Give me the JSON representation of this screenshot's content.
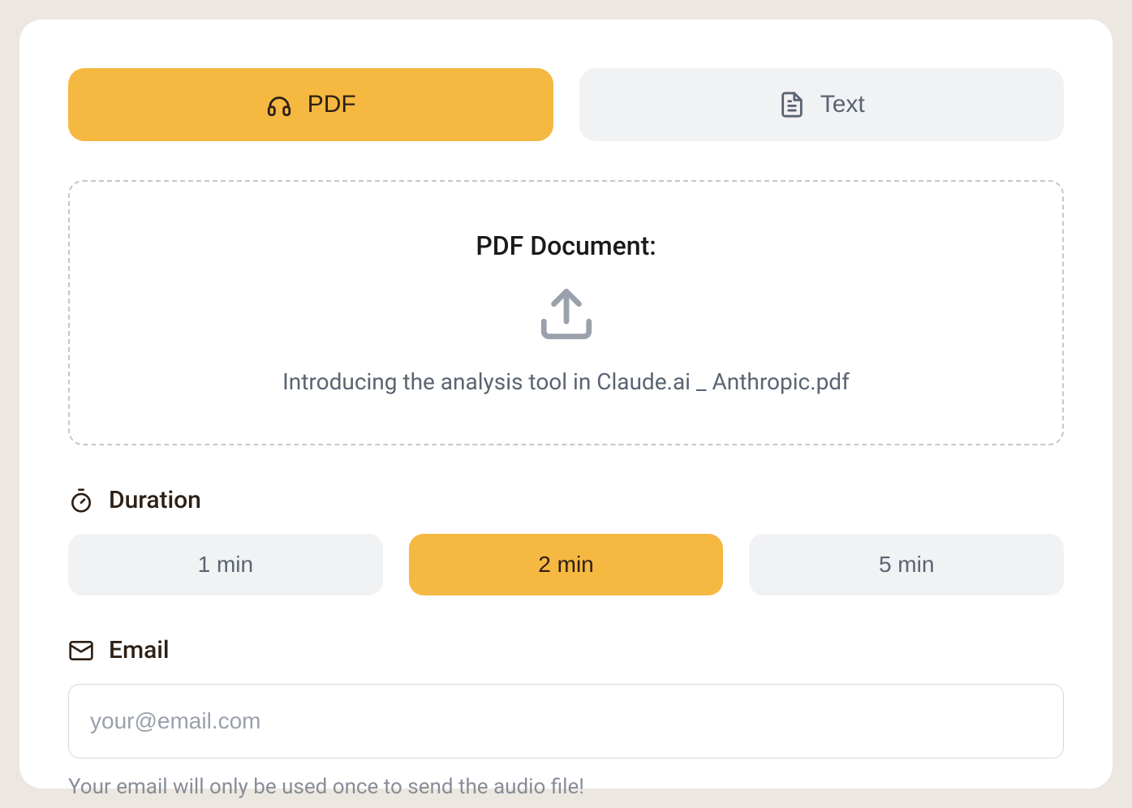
{
  "tabs": {
    "pdf": {
      "label": "PDF",
      "active": true
    },
    "text": {
      "label": "Text",
      "active": false
    }
  },
  "dropzone": {
    "title": "PDF Document:",
    "filename": "Introducing the analysis tool in Claude.ai _ Anthropic.pdf"
  },
  "duration": {
    "label": "Duration",
    "options": [
      {
        "label": "1 min",
        "active": false
      },
      {
        "label": "2 min",
        "active": true
      },
      {
        "label": "5 min",
        "active": false
      }
    ]
  },
  "email": {
    "label": "Email",
    "placeholder": "your@email.com",
    "value": "",
    "hint": "Your email will only be used once to send the audio file!"
  }
}
